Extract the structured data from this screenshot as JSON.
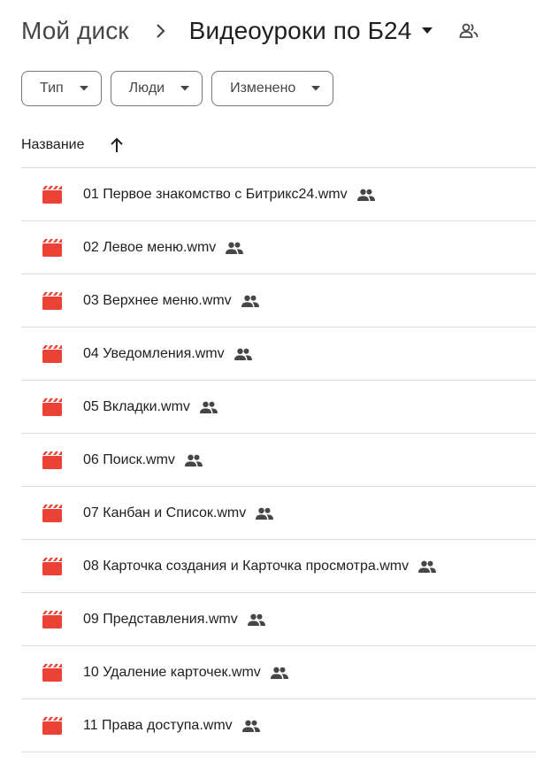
{
  "breadcrumb": {
    "root": "Мой диск",
    "current": "Видеоуроки по Б24"
  },
  "filters": [
    {
      "label": "Тип"
    },
    {
      "label": "Люди"
    },
    {
      "label": "Изменено"
    }
  ],
  "columns": {
    "name": "Название"
  },
  "colors": {
    "video_icon": "#ea4335",
    "icon_gray": "#444746",
    "divider": "#dadce0"
  },
  "files": [
    {
      "name": "01 Первое знакомство с Битрикс24.wmv"
    },
    {
      "name": "02 Левое меню.wmv"
    },
    {
      "name": "03 Верхнее меню.wmv"
    },
    {
      "name": "04 Уведомления.wmv"
    },
    {
      "name": "05 Вкладки.wmv"
    },
    {
      "name": "06 Поиск.wmv"
    },
    {
      "name": "07 Канбан и Список.wmv"
    },
    {
      "name": "08 Карточка создания и Карточка просмотра.wmv"
    },
    {
      "name": "09 Представления.wmv"
    },
    {
      "name": "10 Удаление карточек.wmv"
    },
    {
      "name": "11 Права доступа.wmv"
    }
  ]
}
